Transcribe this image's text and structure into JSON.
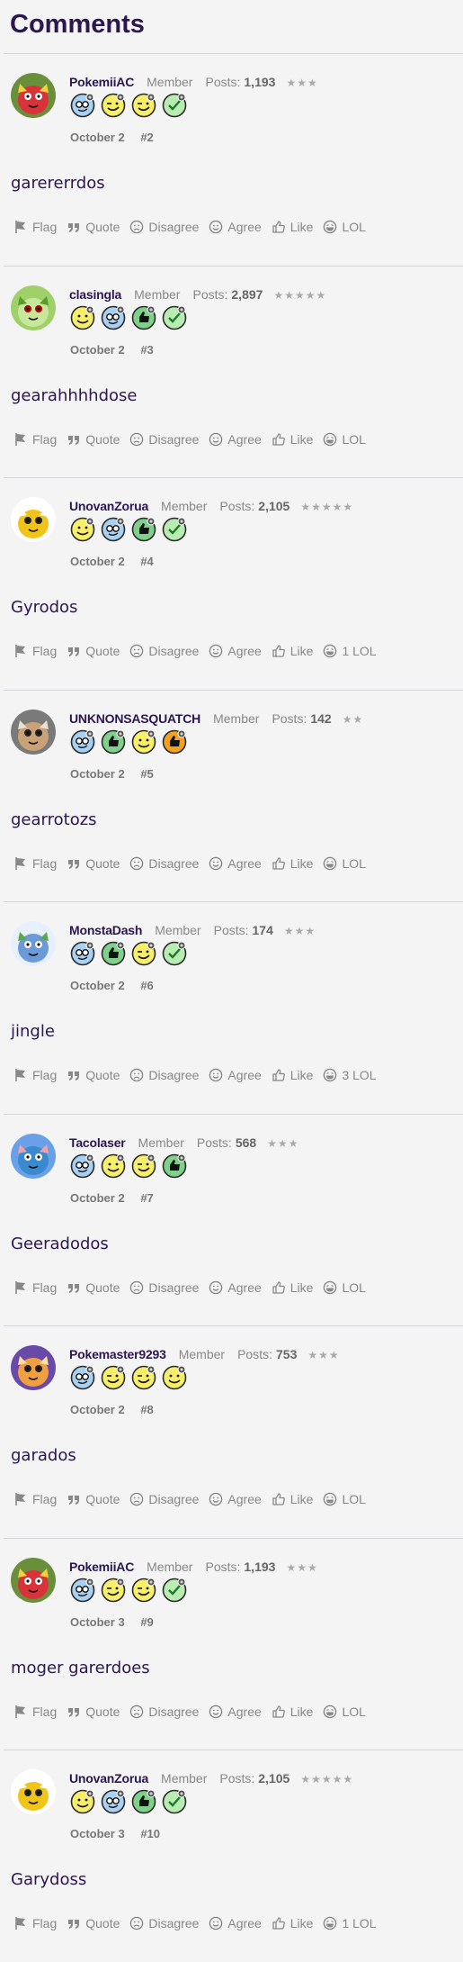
{
  "page": {
    "title": "Comments"
  },
  "actions_labels": {
    "flag": "Flag",
    "quote": "Quote",
    "disagree": "Disagree",
    "agree": "Agree",
    "like": "Like",
    "lol": "LOL"
  },
  "posts": [
    {
      "username": "PokemiiAC",
      "role": "Member",
      "posts_label": "Posts:",
      "posts_count": "1,193",
      "stars": "★★★",
      "avatar": "red-bird-avatar",
      "badges": [
        "blue-nerd-badge",
        "yellow-winking-badge",
        "yellow-winking-badge",
        "green-check-badge"
      ],
      "date": "October 2",
      "number": "#2",
      "body": "garererrdos",
      "lol_label": "LOL"
    },
    {
      "username": "clasingla",
      "role": "Member",
      "posts_label": "Posts:",
      "posts_count": "2,897",
      "stars": "★★★★★",
      "avatar": "leaf-pokemon-avatar",
      "badges": [
        "yellow-smile-badge",
        "blue-nerd-badge",
        "green-thumb-badge",
        "green-check-badge"
      ],
      "date": "October 2",
      "number": "#3",
      "body": "gearahhhhdose",
      "lol_label": "LOL"
    },
    {
      "username": "UnovanZorua",
      "role": "Member",
      "posts_label": "Posts:",
      "posts_count": "2,105",
      "stars": "★★★★★",
      "avatar": "yellow-spiky-avatar",
      "badges": [
        "yellow-smile-badge",
        "blue-nerd-badge",
        "green-thumb-badge",
        "green-check-badge"
      ],
      "date": "October 2",
      "number": "#4",
      "body": "Gyrodos",
      "lol_label": "1 LOL"
    },
    {
      "username": "UNKNONSASQUATCH",
      "role": "Member",
      "posts_label": "Posts:",
      "posts_count": "142",
      "stars": "★★",
      "avatar": "brown-bird-avatar",
      "badges": [
        "blue-nerd-badge",
        "green-thumb-badge",
        "yellow-smile-badge",
        "orange-thumb-badge"
      ],
      "date": "October 2",
      "number": "#5",
      "body": "gearrotozs",
      "lol_label": "LOL"
    },
    {
      "username": "MonstaDash",
      "role": "Member",
      "posts_label": "Posts:",
      "posts_count": "174",
      "stars": "★★★",
      "avatar": "hat-creature-avatar",
      "badges": [
        "blue-nerd-badge",
        "green-thumb-badge",
        "yellow-winking-badge",
        "green-check-badge"
      ],
      "date": "October 2",
      "number": "#6",
      "body": "jingle",
      "lol_label": "3 LOL"
    },
    {
      "username": "Tacolaser",
      "role": "Member",
      "posts_label": "Posts:",
      "posts_count": "568",
      "stars": "★★★",
      "avatar": "blue-water-avatar",
      "badges": [
        "blue-nerd-badge",
        "yellow-smile-badge",
        "yellow-winking-badge",
        "green-thumb-badge"
      ],
      "date": "October 2",
      "number": "#7",
      "body": "Geeradodos",
      "lol_label": "LOL"
    },
    {
      "username": "Pokemaster9293",
      "role": "Member",
      "posts_label": "Posts:",
      "posts_count": "753",
      "stars": "★★★",
      "avatar": "orange-dragon-avatar",
      "badges": [
        "blue-nerd-badge",
        "yellow-winking-badge",
        "yellow-winking-badge",
        "yellow-smile-badge"
      ],
      "date": "October 2",
      "number": "#8",
      "body": "garados",
      "lol_label": "LOL"
    },
    {
      "username": "PokemiiAC",
      "role": "Member",
      "posts_label": "Posts:",
      "posts_count": "1,193",
      "stars": "★★★",
      "avatar": "red-bird-avatar",
      "badges": [
        "blue-nerd-badge",
        "yellow-winking-badge",
        "yellow-winking-badge",
        "green-check-badge"
      ],
      "date": "October 3",
      "number": "#9",
      "body": "moger garerdoes",
      "lol_label": "LOL"
    },
    {
      "username": "UnovanZorua",
      "role": "Member",
      "posts_label": "Posts:",
      "posts_count": "2,105",
      "stars": "★★★★★",
      "avatar": "yellow-spiky-avatar",
      "badges": [
        "yellow-smile-badge",
        "blue-nerd-badge",
        "green-thumb-badge",
        "green-check-badge"
      ],
      "date": "October 3",
      "number": "#10",
      "body": "Garydoss",
      "lol_label": "1 LOL"
    }
  ],
  "colors": {
    "background": "#f4f4f5",
    "heading": "#2b1750",
    "muted": "#888888",
    "divider": "#d4d4d8"
  }
}
